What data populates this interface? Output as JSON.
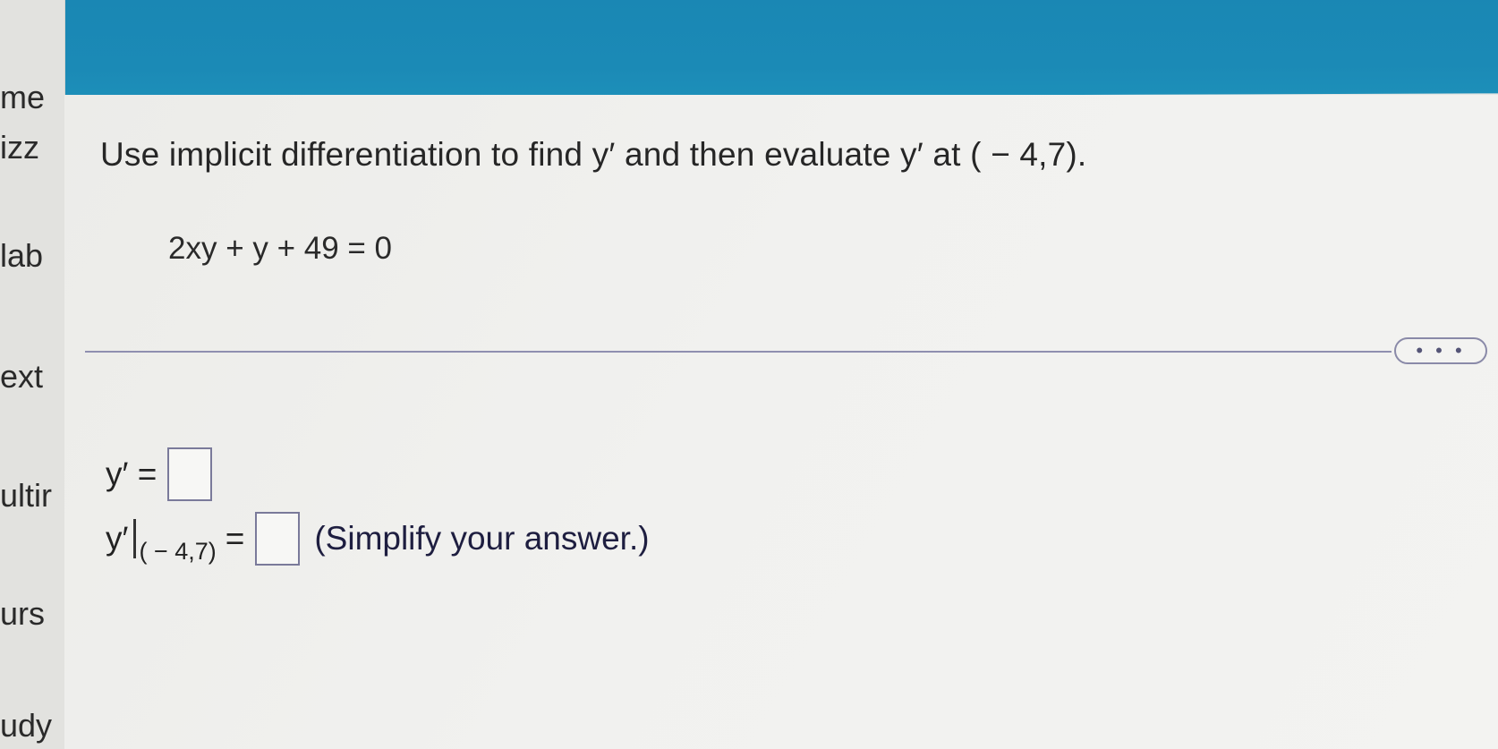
{
  "sidebar": {
    "items": [
      {
        "label": "me"
      },
      {
        "label": "izz"
      },
      {
        "label": "lab"
      },
      {
        "label": "ext"
      },
      {
        "label": "ultir"
      },
      {
        "label": "urs"
      },
      {
        "label": "udy"
      }
    ]
  },
  "question": {
    "prompt": "Use implicit differentiation to find y′ and then evaluate y′ at ( − 4,7).",
    "equation": "2xy + y + 49 = 0"
  },
  "toolbar": {
    "more_label": "• • •"
  },
  "answers": {
    "derivative_label": "y′ =",
    "evaluated_label": "y′",
    "evaluated_point": "( − 4,7)",
    "evaluated_equals": "=",
    "hint": "(Simplify your answer.)"
  },
  "colors": {
    "header_band": "#1a87b4",
    "divider": "#8f8fb0",
    "answer_box_border": "#7a7a9a"
  }
}
